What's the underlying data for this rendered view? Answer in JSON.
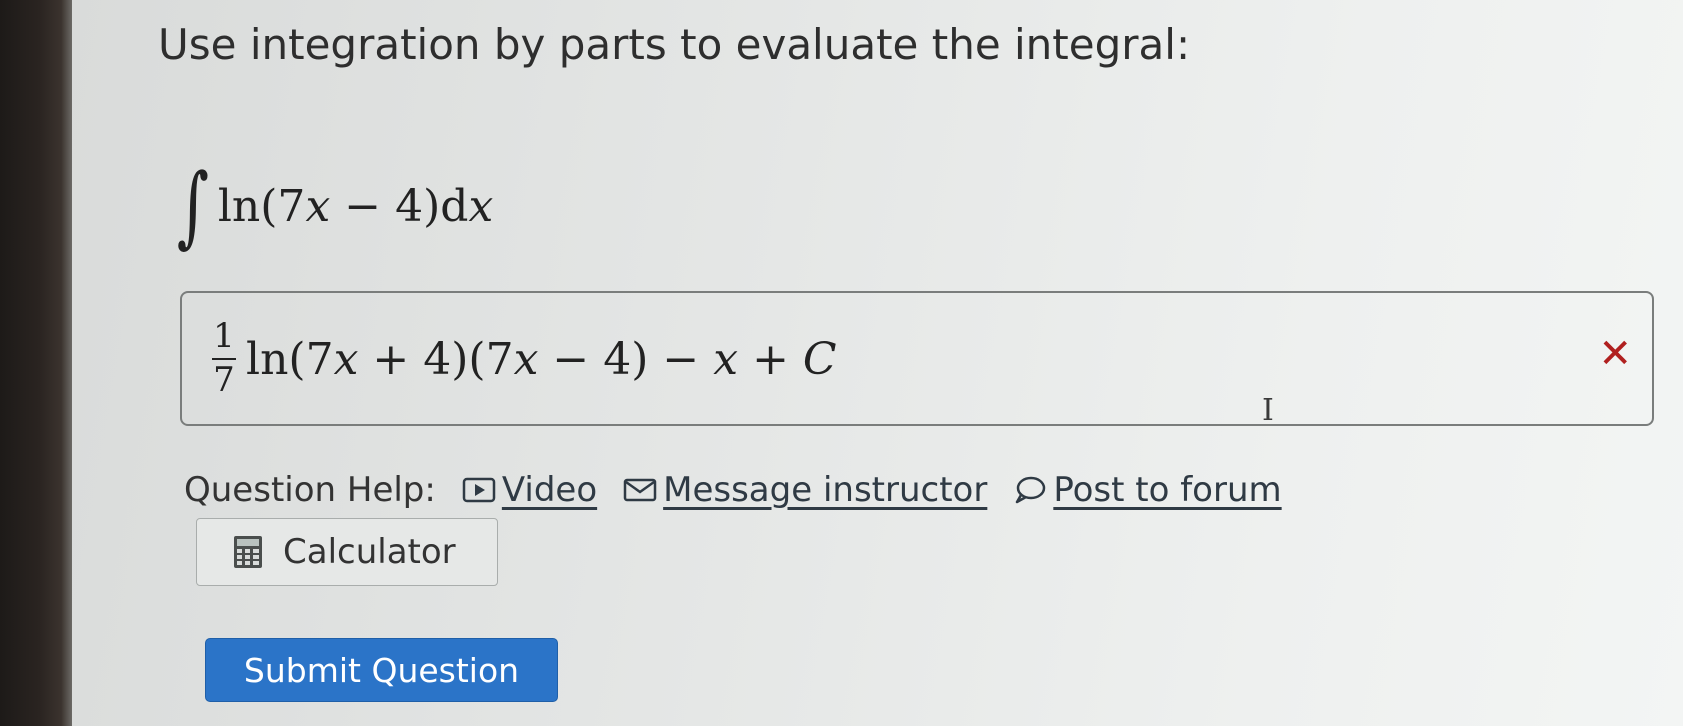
{
  "question": {
    "prompt": "Use integration by parts to evaluate the integral:",
    "integral_sign": "∫",
    "integrand": [
      "ln(7",
      "x",
      " − 4)d",
      "x"
    ]
  },
  "answer": {
    "fraction_numerator": "1",
    "fraction_denominator": "7",
    "expression": [
      "ln(7",
      "x",
      " + 4)(7",
      "x",
      " − 4) − ",
      "x",
      " + ",
      "C"
    ],
    "status_icon": "x-mark-icon",
    "status_symbol": "✕",
    "status_color": "#b0201f",
    "cursor_glyph": "I"
  },
  "help": {
    "label": "Question Help:",
    "links": [
      {
        "icon": "video-icon",
        "label": "Video"
      },
      {
        "icon": "mail-icon",
        "label": "Message instructor"
      },
      {
        "icon": "chat-bubble-icon",
        "label": "Post to forum"
      }
    ]
  },
  "calculator": {
    "icon": "calculator-icon",
    "label": "Calculator"
  },
  "submit": {
    "label": "Submit Question",
    "color": "#2b74c8"
  }
}
